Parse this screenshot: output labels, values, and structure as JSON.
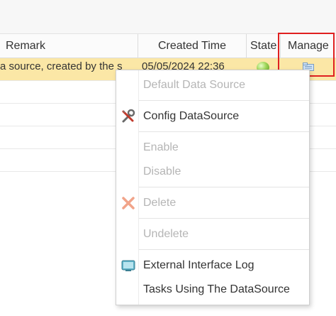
{
  "grid": {
    "columns": {
      "remark": "Remark",
      "created_time": "Created Time",
      "state": "State",
      "manage": "Manage"
    },
    "selected_row": {
      "remark": "a source, created by the s",
      "created_time": "05/05/2024 22:36"
    }
  },
  "context_menu": {
    "items": [
      {
        "label": "Default Data Source",
        "enabled": false,
        "icon": ""
      },
      {
        "label": "Config DataSource",
        "enabled": true,
        "icon": "tools-icon"
      },
      {
        "label": "Enable",
        "enabled": false,
        "icon": ""
      },
      {
        "label": "Disable",
        "enabled": false,
        "icon": ""
      },
      {
        "label": "Delete",
        "enabled": false,
        "icon": "delete-x-icon"
      },
      {
        "label": "Undelete",
        "enabled": false,
        "icon": ""
      },
      {
        "label": "External Interface Log",
        "enabled": true,
        "icon": "log-monitor-icon"
      },
      {
        "label": "Tasks Using The DataSource",
        "enabled": true,
        "icon": ""
      }
    ]
  },
  "colors": {
    "selected_row": "#fbe7a6",
    "highlight_border": "#e02020",
    "disabled_text": "#b5b5b5",
    "state_ok": "#9fd65a"
  }
}
